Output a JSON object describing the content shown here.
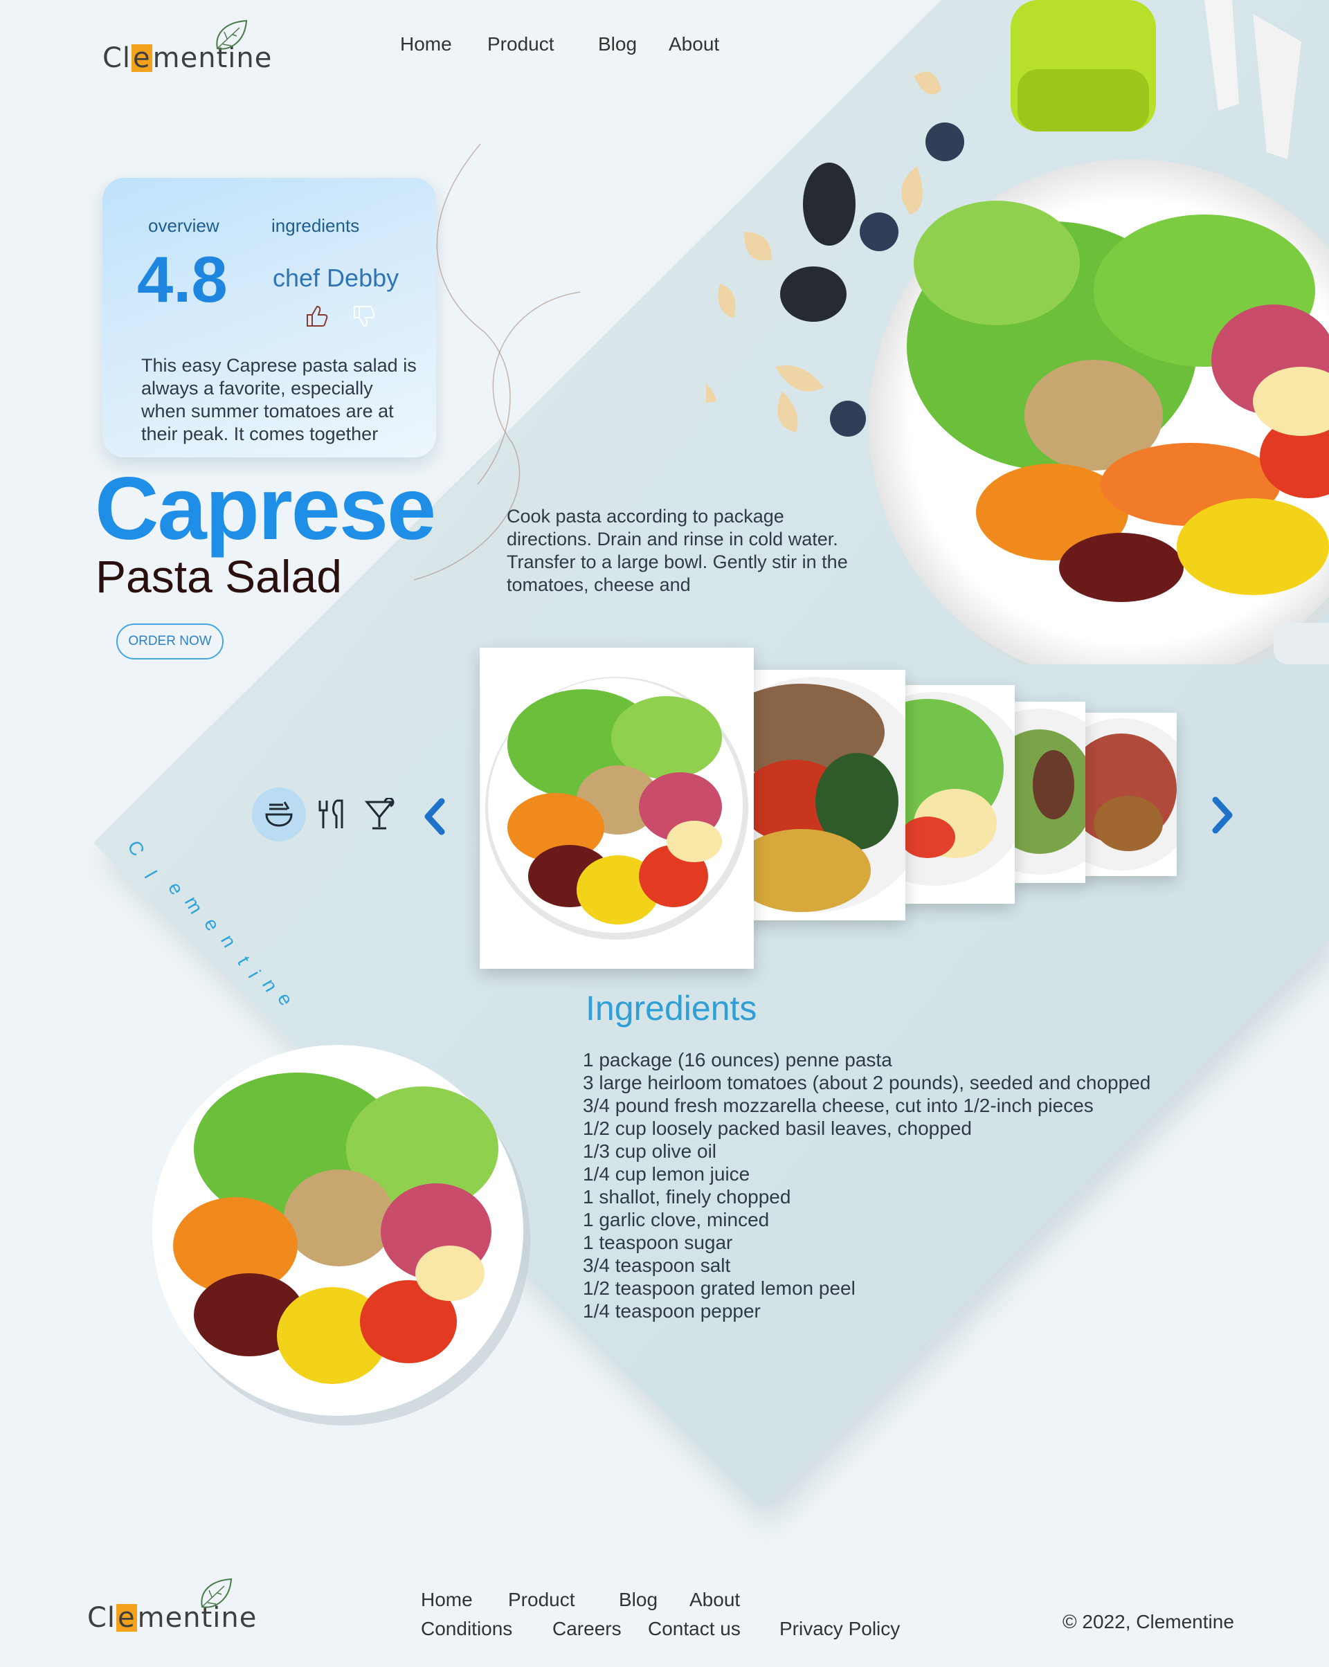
{
  "brand": {
    "logo_text_before": "Cl",
    "logo_text_highlight": "e",
    "logo_text_after": "mentine",
    "vertical_letters": [
      "C",
      "l",
      "e",
      "m",
      "e",
      "n",
      "t",
      "i",
      "n",
      "e"
    ],
    "accent": "#1e8ee6",
    "highlight_color": "#f4a21b"
  },
  "nav": {
    "home": "Home",
    "product": "Product",
    "blog": "Blog",
    "about": "About"
  },
  "card": {
    "tab_overview": "overview",
    "tab_ingredients": "ingredients",
    "rating": "4.8",
    "chef": "chef Debby",
    "description": "This easy Caprese pasta salad is always a favorite, especially when summer tomatoes are at their peak. It comes together"
  },
  "hero": {
    "title": "Caprese",
    "subtitle": "Pasta Salad",
    "order_button": "ORDER NOW",
    "cook_text": "Cook pasta according to package directions. Drain and rinse in cold water. Transfer to a large bowl. Gently stir in the tomatoes, cheese and"
  },
  "categories": [
    {
      "icon": "bowl-icon",
      "active": true
    },
    {
      "icon": "fork-knife-icon",
      "active": false
    },
    {
      "icon": "cocktail-icon",
      "active": false
    }
  ],
  "ingredients": {
    "title": "Ingredients",
    "items": [
      "1 package (16 ounces) penne pasta",
      "3 large heirloom tomatoes (about 2 pounds), seeded and chopped",
      "3/4 pound fresh mozzarella cheese, cut into 1/2-inch pieces",
      "1/2 cup loosely packed basil leaves, chopped",
      "1/3 cup olive oil",
      "1/4 cup lemon juice",
      "1 shallot, finely chopped",
      "1 garlic clove, minced",
      "1 teaspoon sugar",
      "3/4 teaspoon salt",
      "1/2 teaspoon grated lemon peel",
      "1/4 teaspoon pepper"
    ]
  },
  "footer": {
    "home": "Home",
    "product": "Product",
    "blog": "Blog",
    "about": "About",
    "conditions": "Conditions",
    "careers": "Careers",
    "contact": "Contact us",
    "privacy": "Privacy Policy",
    "copyright": "© 2022, Clementine"
  }
}
